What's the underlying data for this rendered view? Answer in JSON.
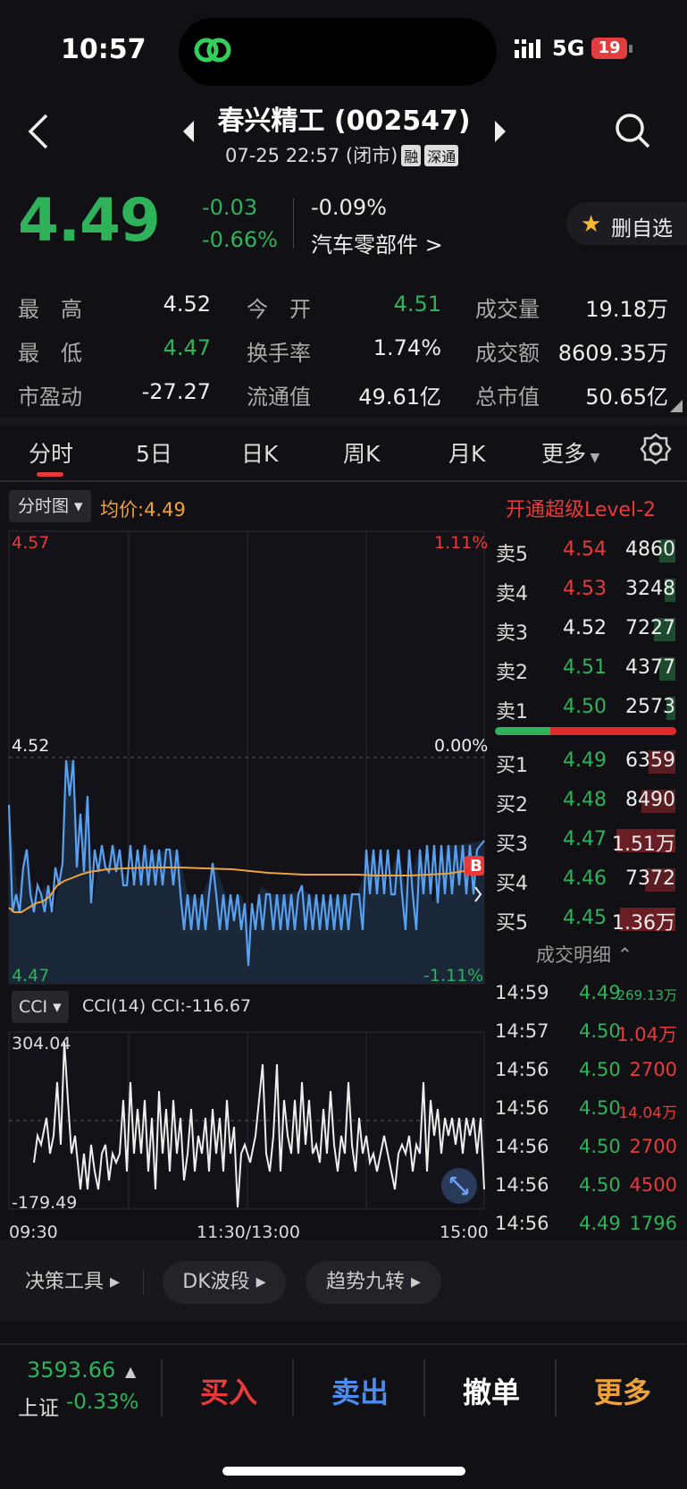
{
  "status": {
    "time": "10:57",
    "network": "5G",
    "battery": "19"
  },
  "header": {
    "title": "春兴精工 (002547)",
    "date_time": "07-25 22:57 (闭市)",
    "tag_margin": "融",
    "tag_market": "深通"
  },
  "quote": {
    "price": "4.49",
    "change": "-0.03",
    "change_pct": "-0.66%",
    "change2": "-0.09%",
    "sector": "汽车零部件 >",
    "favorite_label": "删自选"
  },
  "stats": {
    "high_label": "最　高",
    "high": "4.52",
    "open_label": "今　开",
    "open": "4.51",
    "vol_label": "成交量",
    "vol": "19.18万",
    "low_label": "最　低",
    "low": "4.47",
    "turnover_label": "换手率",
    "turnover": "1.74%",
    "amount_label": "成交额",
    "amount": "8609.35万",
    "pe_label": "市盈动",
    "pe": "-27.27",
    "float_label": "流通值",
    "float": "49.61亿",
    "mcap_label": "总市值",
    "mcap": "50.65亿"
  },
  "tabs": [
    "分时",
    "5日",
    "日K",
    "周K",
    "月K",
    "更多"
  ],
  "chart": {
    "mode_button": "分时图",
    "avg_label": "均价:4.49",
    "level2_label": "开通超级Level-2",
    "y_top": "4.57",
    "y_mid": "4.52",
    "y_bot": "4.47",
    "pct_top": "1.11%",
    "pct_mid": "0.00%",
    "pct_bot": "-1.11%",
    "marker": "B",
    "cci_button": "CCI",
    "cci_label": "CCI(14)  CCI:-116.67",
    "cci_top": "304.04",
    "cci_bot": "-179.49",
    "x_start": "09:30",
    "x_mid": "11:30/13:00",
    "x_end": "15:00"
  },
  "orderbook": {
    "asks": [
      {
        "label": "卖5",
        "price": "4.54",
        "vol": "4860"
      },
      {
        "label": "卖4",
        "price": "4.53",
        "vol": "3248"
      },
      {
        "label": "卖3",
        "price": "4.52",
        "vol": "7227"
      },
      {
        "label": "卖2",
        "price": "4.51",
        "vol": "4377"
      },
      {
        "label": "卖1",
        "price": "4.50",
        "vol": "2573"
      }
    ],
    "bids": [
      {
        "label": "买1",
        "price": "4.49",
        "vol": "6359"
      },
      {
        "label": "买2",
        "price": "4.48",
        "vol": "8490"
      },
      {
        "label": "买3",
        "price": "4.47",
        "vol": "1.51万"
      },
      {
        "label": "买4",
        "price": "4.46",
        "vol": "7372"
      },
      {
        "label": "买5",
        "price": "4.45",
        "vol": "1.36万"
      }
    ],
    "detail_header": "成交明细",
    "trades": [
      {
        "time": "14:59",
        "price": "4.49",
        "vol": "269.13万"
      },
      {
        "time": "14:57",
        "price": "4.50",
        "vol": "1.04万"
      },
      {
        "time": "14:56",
        "price": "4.50",
        "vol": "2700"
      },
      {
        "time": "14:56",
        "price": "4.50",
        "vol": "14.04万"
      },
      {
        "time": "14:56",
        "price": "4.50",
        "vol": "2700"
      },
      {
        "time": "14:56",
        "price": "4.50",
        "vol": "4500"
      },
      {
        "time": "14:56",
        "price": "4.49",
        "vol": "1796"
      }
    ]
  },
  "tools": {
    "t1": "决策工具",
    "t2": "DK波段",
    "t3": "趋势九转"
  },
  "bottom": {
    "index_value": "3593.66",
    "index_name": "上证",
    "index_pct": "-0.33%",
    "buy": "买入",
    "sell": "卖出",
    "cancel": "撤单",
    "more": "更多"
  },
  "colors": {
    "up": "#e83a3a",
    "down": "#2eb35a",
    "price_line": "#5aa0f0",
    "avg_line": "#f0a23a"
  }
}
